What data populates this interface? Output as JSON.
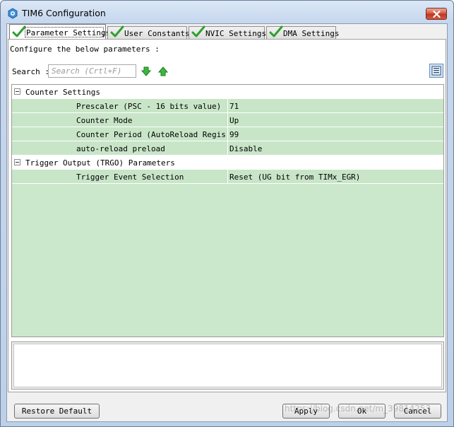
{
  "window": {
    "title": "TIM6 Configuration",
    "icon": "gear-hex-icon",
    "accent_color": "#c8e5c8"
  },
  "tabs": [
    {
      "label": "Parameter Settings",
      "active": true
    },
    {
      "label": "User Constants",
      "active": false
    },
    {
      "label": "NVIC Settings",
      "active": false
    },
    {
      "label": "DMA Settings",
      "active": false
    }
  ],
  "panel": {
    "configure_text": "Configure the below parameters :",
    "search_label": "Search :",
    "search_placeholder": "Search (Crtl+F)",
    "search_value": ""
  },
  "groups": [
    {
      "name": "Counter Settings",
      "rows": [
        {
          "param": "Prescaler (PSC - 16 bits value)",
          "value": "71"
        },
        {
          "param": "Counter Mode",
          "value": "Up"
        },
        {
          "param": "Counter Period (AutoReload Regis...",
          "value": "99"
        },
        {
          "param": "auto-reload preload",
          "value": "Disable"
        }
      ]
    },
    {
      "name": "Trigger Output (TRGO) Parameters",
      "rows": [
        {
          "param": "Trigger Event Selection",
          "value": "Reset (UG bit from TIMx_EGR)"
        }
      ]
    }
  ],
  "buttons": {
    "restore_default": "Restore Default",
    "apply": "Apply",
    "ok": "Ok",
    "cancel": "Cancel"
  },
  "watermark": "https://blog.csdn.net/m_39814253"
}
